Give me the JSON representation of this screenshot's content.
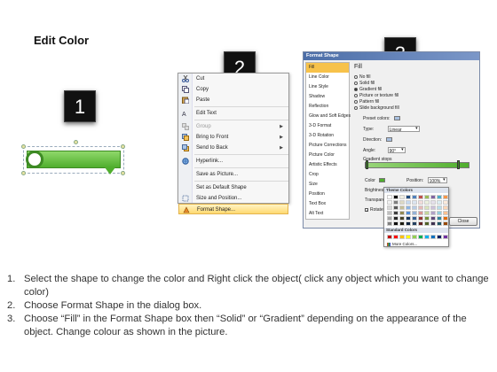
{
  "page_title": "Edit Color",
  "steps": [
    "1",
    "2",
    "3"
  ],
  "context_menu": {
    "items": [
      {
        "label": "Cut",
        "icon": "scissors-icon",
        "state": "enabled"
      },
      {
        "label": "Copy",
        "icon": "copy-icon",
        "state": "enabled"
      },
      {
        "label": "Paste",
        "icon": "paste-icon",
        "state": "enabled"
      },
      {
        "label": "Edit Text",
        "icon": "edit-text-icon",
        "state": "enabled"
      },
      {
        "label": "Group",
        "icon": "group-icon",
        "state": "disabled",
        "submenu": true
      },
      {
        "label": "Bring to Front",
        "icon": "bring-front-icon",
        "state": "enabled",
        "submenu": true
      },
      {
        "label": "Send to Back",
        "icon": "send-back-icon",
        "state": "enabled",
        "submenu": true
      },
      {
        "label": "Hyperlink...",
        "icon": "hyperlink-icon",
        "state": "enabled"
      },
      {
        "label": "Save as Picture...",
        "icon": "",
        "state": "enabled"
      },
      {
        "label": "Set as Default Shape",
        "icon": "",
        "state": "enabled"
      },
      {
        "label": "Size and Position...",
        "icon": "size-position-icon",
        "state": "enabled"
      },
      {
        "label": "Format Shape...",
        "icon": "format-shape-icon",
        "state": "highlighted"
      }
    ]
  },
  "dialog": {
    "title": "Format Shape",
    "nav_items": [
      "Fill",
      "Line Color",
      "Line Style",
      "Shadow",
      "Reflection",
      "Glow and Soft Edges",
      "3-D Format",
      "3-D Rotation",
      "Picture Corrections",
      "Picture Color",
      "Artistic Effects",
      "Crop",
      "Size",
      "Position",
      "Text Box",
      "Alt Text"
    ],
    "selected_nav": "Fill",
    "panel_heading": "Fill",
    "fill_options": [
      {
        "label": "No fill",
        "checked": false
      },
      {
        "label": "Solid fill",
        "checked": false
      },
      {
        "label": "Gradient fill",
        "checked": true
      },
      {
        "label": "Picture or texture fill",
        "checked": false
      },
      {
        "label": "Pattern fill",
        "checked": false
      },
      {
        "label": "Slide background fill",
        "checked": false
      }
    ],
    "preset_colors_label": "Preset colors:",
    "type_label": "Type:",
    "type_value": "Linear",
    "direction_label": "Direction:",
    "angle_label": "Angle:",
    "angle_value": "90°",
    "gradient_stops_label": "Gradient stops",
    "color_label": "Color",
    "position_label": "Position:",
    "position_value": "100%",
    "brightness_label": "Brightness:",
    "transparency_label": "Transparency:",
    "rotate_label": "Rotate with shape",
    "close_label": "Close",
    "gradient_colors": {
      "start": "#9ad67a",
      "end": "#4fae2d"
    }
  },
  "color_picker": {
    "theme_colors_label": "Theme Colors",
    "standard_colors_label": "Standard Colors",
    "more_colors_label": "More Colors...",
    "theme_top_row": [
      "#ffffff",
      "#000000",
      "#eeece1",
      "#1f497d",
      "#4f81bd",
      "#c0504d",
      "#9bbb59",
      "#8064a2",
      "#4bacc6",
      "#f79646"
    ],
    "theme_shade_rows": [
      [
        "#f2f2f2",
        "#7f7f7f",
        "#ddd9c3",
        "#c6d9f0",
        "#dbe5f1",
        "#f2dcdb",
        "#ebf1dd",
        "#e5e0ec",
        "#dbeef3",
        "#fdeada"
      ],
      [
        "#d8d8d8",
        "#595959",
        "#c4bd97",
        "#8db3e2",
        "#b8cce4",
        "#e5b9b7",
        "#d7e3bc",
        "#ccc1d9",
        "#b7dde8",
        "#fbd5b5"
      ],
      [
        "#bfbfbf",
        "#3f3f3f",
        "#938953",
        "#548dd4",
        "#95b3d7",
        "#d99694",
        "#c3d69b",
        "#b2a2c7",
        "#92cddc",
        "#fac08f"
      ],
      [
        "#a5a5a5",
        "#262626",
        "#494429",
        "#17365d",
        "#366092",
        "#953734",
        "#76923c",
        "#5f497a",
        "#31859b",
        "#e36c09"
      ],
      [
        "#7f7f7f",
        "#0c0c0c",
        "#1d1b10",
        "#0f243e",
        "#244061",
        "#632423",
        "#4f6128",
        "#3f3151",
        "#205867",
        "#974806"
      ]
    ],
    "standard_row": [
      "#c00000",
      "#ff0000",
      "#ffc000",
      "#ffff00",
      "#92d050",
      "#00b050",
      "#00b0f0",
      "#0070c0",
      "#002060",
      "#7030a0"
    ]
  },
  "instructions": [
    {
      "num": "1.",
      "text": "Select the shape to change the color and Right click the object( click any object which you want to change color)"
    },
    {
      "num": "2.",
      "text": "Choose Format Shape in the dialog box."
    },
    {
      "num": "3.",
      "text": "Choose “Fill” in the Format Shape box then “Solid” or “Gradient” depending on the appearance of the object. Change colour as shown in the picture."
    }
  ],
  "colors": {
    "shape_green": "#4fae2d",
    "highlight": "#f7c24a",
    "step_box": "#111111"
  }
}
